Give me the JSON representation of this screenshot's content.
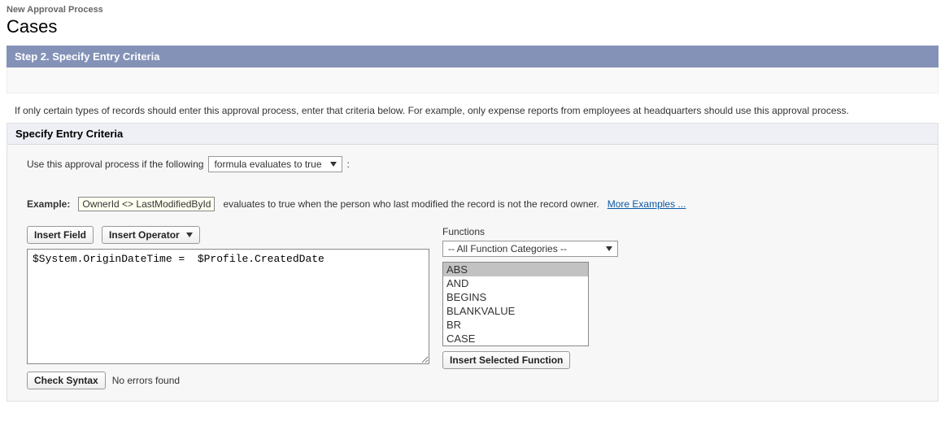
{
  "header": {
    "breadcrumb": "New Approval Process",
    "title": "Cases"
  },
  "step_bar": "Step 2. Specify Entry Criteria",
  "instructions": "If only certain types of records should enter this approval process, enter that criteria below. For example, only expense reports from employees at headquarters should use this approval process.",
  "panel_title": "Specify Entry Criteria",
  "condition": {
    "prefix": "Use this approval process if the following",
    "select_value": "formula evaluates to true",
    "suffix": ":"
  },
  "example": {
    "label": "Example:",
    "code": "OwnerId <> LastModifiedById",
    "desc": "evaluates to true when the person who last modified the record is not the record owner.",
    "link": "More Examples ..."
  },
  "buttons": {
    "insert_field": "Insert Field",
    "insert_operator": "Insert Operator",
    "check_syntax": "Check Syntax",
    "insert_selected_function": "Insert Selected Function"
  },
  "formula_value": "$System.OriginDateTime =  $Profile.CreatedDate",
  "functions": {
    "label": "Functions",
    "category": "-- All Function Categories --",
    "items": [
      "ABS",
      "AND",
      "BEGINS",
      "BLANKVALUE",
      "BR",
      "CASE"
    ],
    "selected_index": 0
  },
  "syntax_status": "No errors found"
}
